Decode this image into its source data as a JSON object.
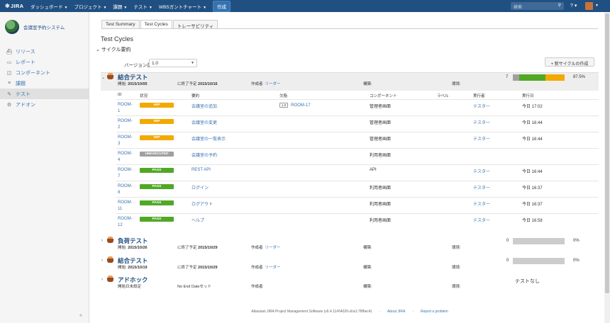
{
  "header": {
    "logo": "JIRA",
    "nav": [
      {
        "label": "ダッシュボード"
      },
      {
        "label": "プロジェクト"
      },
      {
        "label": "課題"
      },
      {
        "label": "テスト"
      },
      {
        "label": "WBSガントチャート"
      }
    ],
    "create": "作成",
    "search_placeholder": "検索",
    "help_icon": "?",
    "colors": {
      "bar": "#205081",
      "create": "#3572b0"
    }
  },
  "sidebar": {
    "project_name": "会議室予約システム",
    "items": [
      {
        "label": "リリース",
        "icon": "ship-icon"
      },
      {
        "label": "レポート",
        "icon": "report-icon"
      },
      {
        "label": "コンポーネント",
        "icon": "component-icon"
      },
      {
        "label": "課題",
        "icon": "issues-icon"
      },
      {
        "label": "テスト",
        "icon": "test-icon",
        "active": true
      },
      {
        "label": "アドオン",
        "icon": "addon-icon"
      }
    ],
    "collapse": "«"
  },
  "tabs": [
    {
      "label": "Test Summary"
    },
    {
      "label": "Test Cycles",
      "active": true
    },
    {
      "label": "トレーサビリティ"
    }
  ],
  "page_title": "Test Cycles",
  "section_title": "サイクル要約",
  "version": {
    "label": "バージョン選択:",
    "value": "1.0"
  },
  "new_cycle_button": "+ 新サイクルの作成",
  "cycles": [
    {
      "name": "結合テスト",
      "start_label": "開始:",
      "start": "2015/10/05",
      "end_label": "に終了予定",
      "end": "2015/10/16",
      "creator_label": "作成者",
      "creator": "リーダー",
      "build_label": "構築:",
      "env_label": "環境:",
      "count": "7",
      "percent": "87.5%",
      "progress": [
        {
          "fraction": 0.125,
          "color": "#a0a0a0"
        },
        {
          "fraction": 0.5,
          "color": "#51a825"
        },
        {
          "fraction": 0.375,
          "color": "#f2a900"
        }
      ]
    },
    {
      "name": "負荷テスト",
      "start_label": "開始:",
      "start": "2015/10/26",
      "end_label": "に終了予定",
      "end": "2015/10/29",
      "creator_label": "作成者",
      "creator": "リーダー",
      "build_label": "構築:",
      "env_label": "環境:",
      "count": "0",
      "percent": "0%"
    },
    {
      "name": "結合テスト",
      "start_label": "開始:",
      "start": "2015/10/19",
      "end_label": "に終了予定",
      "end": "2015/10/29",
      "creator_label": "作成者",
      "creator": "リーダー",
      "build_label": "構築:",
      "env_label": "環境:",
      "count": "0",
      "percent": "0%"
    },
    {
      "name": "アドホック",
      "start_label": "開始日未設定",
      "end_label": "No End Dateセット",
      "creator_label": "作成者",
      "build_label": "構築:",
      "env_label": "環境:",
      "none": "テストなし"
    }
  ],
  "table": {
    "headers": {
      "id": "ID",
      "status": "状況",
      "summary": "要約",
      "defect": "欠陥",
      "component": "コンポーネント",
      "label": "ラベル",
      "executed_by": "実行者",
      "executed_on": "実行日"
    },
    "rows": [
      {
        "id_a": "ROOM-",
        "id_b": "1",
        "status": "WIP",
        "status_color": "#f2a900",
        "summary": "会議室の追加",
        "defect_priority": "1.0",
        "defect": "ROOM-17",
        "component": "管理者画面",
        "executed_by": "テスター",
        "executed_on": "今日 17:02"
      },
      {
        "id_a": "ROOM-",
        "id_b": "2",
        "status": "WIP",
        "status_color": "#f2a900",
        "summary": "会議室の変更",
        "component": "管理者画面",
        "executed_by": "テスター",
        "executed_on": "今日 16:44"
      },
      {
        "id_a": "ROOM-",
        "id_b": "3",
        "status": "WIP",
        "status_color": "#f2a900",
        "summary": "会議室の一覧表示",
        "component": "管理者画面",
        "executed_by": "テスター",
        "executed_on": "今日 16:44"
      },
      {
        "id_a": "ROOM-",
        "id_b": "4",
        "status": "UNEXECUTED",
        "status_color": "#a0a0a0",
        "summary": "会議室の予約",
        "component": "利用者画面"
      },
      {
        "id_a": "ROOM-",
        "id_b": "7",
        "status": "PASS",
        "status_color": "#51a825",
        "summary": "REST API",
        "component": "API",
        "executed_by": "テスター",
        "executed_on": "今日 16:44"
      },
      {
        "id_a": "ROOM-",
        "id_b": "8",
        "status": "PASS",
        "status_color": "#51a825",
        "summary": "ログイン",
        "component": "利用者画面",
        "executed_by": "テスター",
        "executed_on": "今日 16:37"
      },
      {
        "id_a": "ROOM-",
        "id_b": "11",
        "status": "PASS",
        "status_color": "#51a825",
        "summary": "ログアウト",
        "component": "利用者画面",
        "executed_by": "テスター",
        "executed_on": "今日 16:37"
      },
      {
        "id_a": "ROOM-",
        "id_b": "12",
        "status": "PASS",
        "status_color": "#51a825",
        "summary": "ヘルプ",
        "component": "利用者画面",
        "executed_by": "テスター",
        "executed_on": "今日 16:58"
      }
    ]
  },
  "footer": {
    "software": "Atlassian JIRA Project Management Software (v6.4.11#64026-sha1:78f6ec4)",
    "about": "About JIRA",
    "report": "Report a problem"
  }
}
